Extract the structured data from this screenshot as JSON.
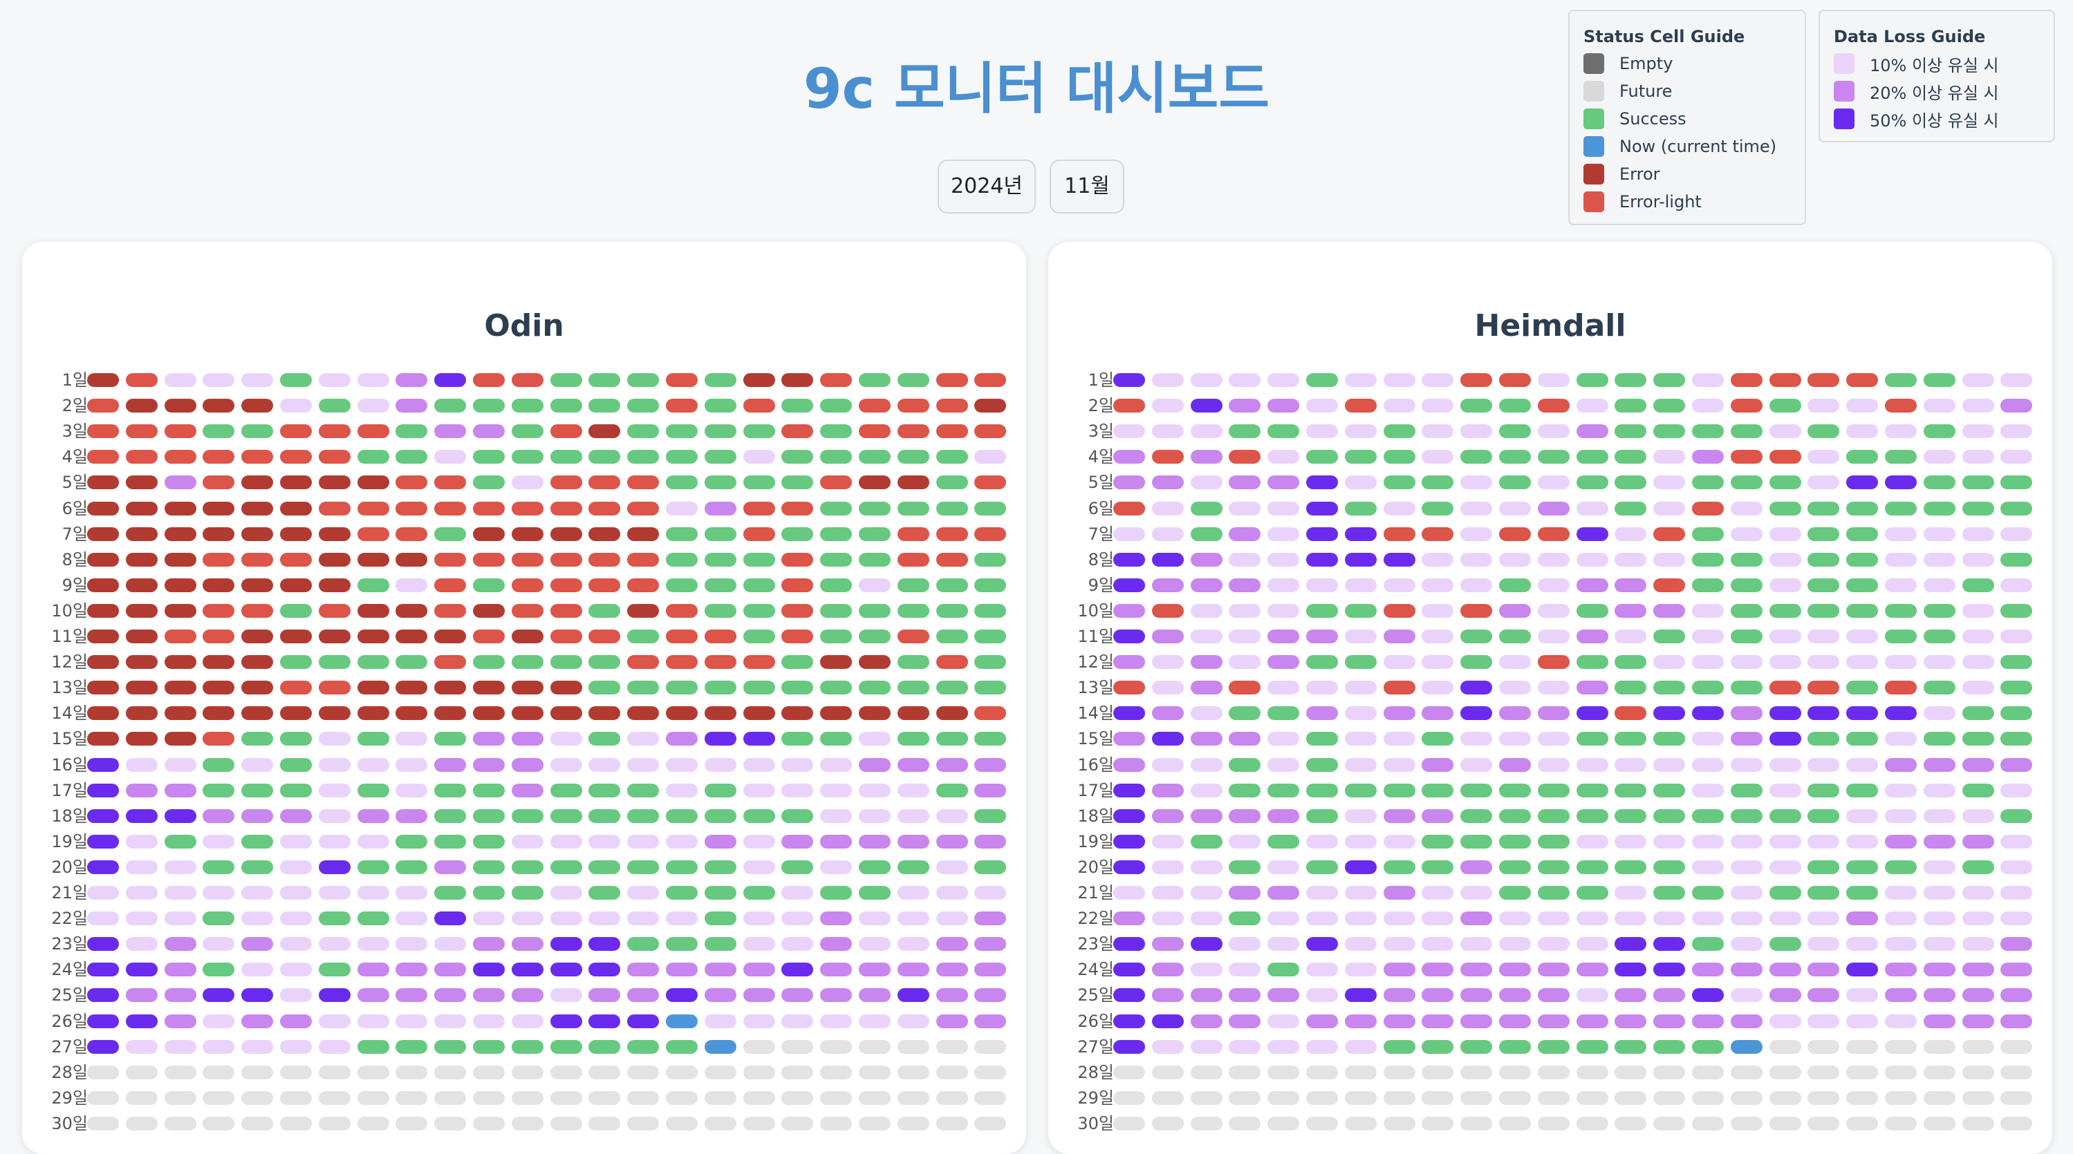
{
  "header": {
    "title": "9c 모니터 대시보드"
  },
  "selectors": {
    "year": "2024년",
    "month": "11월"
  },
  "status_legend": {
    "title": "Status Cell Guide",
    "items": [
      {
        "label": "Empty",
        "color": "#6e6e6e"
      },
      {
        "label": "Future",
        "color": "#d9d9d9"
      },
      {
        "label": "Success",
        "color": "#66c97f"
      },
      {
        "label": "Now (current time)",
        "color": "#4d95d9"
      },
      {
        "label": "Error",
        "color": "#b23b31"
      },
      {
        "label": "Error-light",
        "color": "#dd5448"
      }
    ]
  },
  "loss_legend": {
    "title": "Data Loss Guide",
    "items": [
      {
        "label": "10% 이상 유실 시",
        "color": "#ead3fb"
      },
      {
        "label": "20% 이상 유실 시",
        "color": "#c886ee"
      },
      {
        "label": "50% 이상 유실 시",
        "color": "#6a2bef"
      }
    ]
  },
  "colors": {
    "S": "#66c97f",
    "E": "#b23b31",
    "R": "#dd5448",
    "F": "#e3e3e3",
    "N": "#4d95d9",
    "L": "#ead3fb",
    "M": "#c886ee",
    "D": "#6a2bef"
  },
  "days": [
    "1일",
    "2일",
    "3일",
    "4일",
    "5일",
    "6일",
    "7일",
    "8일",
    "9일",
    "10일",
    "11일",
    "12일",
    "13일",
    "14일",
    "15일",
    "16일",
    "17일",
    "18일",
    "19일",
    "20일",
    "21일",
    "22일",
    "23일",
    "24일",
    "25일",
    "26일",
    "27일",
    "28일",
    "29일",
    "30일"
  ],
  "panels": [
    {
      "name": "Odin",
      "rows": [
        "ERLLLSLLMDRRSSSRSEERSSRR",
        "REEEELSLMSSSSSSRSRSSRRRE",
        "RRRSSRRRSMMSRESSSSRSRRRR",
        "RRRRRRRSSLSSSSSSSLSSSSSL",
        "EEMREEEERRSLRRRSSSSREESR",
        "EEEEEERRRRRRRRRLMRRSSSSS",
        "EEEEEEERRSEEEEESSRSSSRRR",
        "EEERRREEERRRRRRSSSRSSRRS",
        "EEEEEEESLRSRRRRSSSRSLSSS",
        "EEERRSREERERRSERSSRSSSSS",
        "EERREEEEEERERRSRRSRSSRSS",
        "EEEEESSSSRSSSSRRRRSEESRS",
        "EEEEERREEEEEESSSSSSSSSSS",
        "EEEEEEEEEEEEEEEEEEEEEEER",
        "EEERSSLSLSMMLSLMDDSSLSSS",
        "DLLSLSLLLMMMLLLLLLLLMMMM",
        "DMMSSSLSLSSMSSSLSLLLLLSM",
        "DDDMMMLMMSSSSSSSSSSLLLLS",
        "DLSLSLLLSSSLLLLLMLMMMMMM",
        "DLLSSLDSSMSSSSSSSLSLSSLS",
        "LLLLLLLLLSSSLSLSSSLSSLLL",
        "LLLSLLSSLDLLLLLLSLLMLLLM",
        "DLMLMLLLLLMMDDSSSLLMLLMM",
        "DDMSLLSMMMDDDDMMMMDMMMMM",
        "DMMDDLDMMMMMLMMDMMMMMDMM",
        "DDMLMMLLLLLLDDDNLLLLLLMM",
        "DLLLLLLSSSSSSSSSNFFFFFFF",
        "FFFFFFFFFFFFFFFFFFFFFFFF",
        "FFFFFFFFFFFFFFFFFFFFFFFF",
        "FFFFFFFFFFFFFFFFFFFFFFFF"
      ]
    },
    {
      "name": "Heimdall",
      "rows": [
        "DLLLLSLLLRRLSSSLRRRRSSLL",
        "RLDMMLRLLSSRLSSLRSLLRLLM",
        "LLLSSLLSLLSLMSSSSLSLLSLL",
        "MRMRLSSSLSSSSSLMRRLSSLLL",
        "MMLMMDLSSLSLSSLSSSLDDSSS",
        "RLSLLDSLSLLMLSLRLSSSSSSS",
        "LLSMLDDRRLRRDLRSLLSSLLLL",
        "DDMLLDDDLLLLLLLSSLSSLLLS",
        "DMMMLLLLLLSLMMRSSLSSLLSL",
        "MRLLLSSRLRMLSMMLSSSSSSLS",
        "DMLLMMLMLSSLMLSLSLLLSSLL",
        "MLMLMSSLLSLRSSLLLLLLLLLS",
        "RLMRLLLRLDLLMSSSSRRSRSLS",
        "DMLSSMLMMDMMDRDDMDDDDLSS",
        "MDMMLSLLSLLLSSSLMDSSLSSS",
        "MLLSLSLLMLMLLLLLLLLLMMMM",
        "DMLSSSSSSSSSSSSLSLSSLLSL",
        "DMMMMSLMMSSSSSSSSSSLLLLS",
        "DLSLSLLLSSSSLLLLLLLLMMML",
        "DLLSLSDSSMSSSSSLLLSSSLSL",
        "LLLMMLLMLLSSSLSSLSSSLLLL",
        "MLLSLLLLLMLLLLLLLLLMLLLL",
        "DMDLLDLLLLLLLDDSLSLLLLLM",
        "DMLLSLLMMMMMMDDMMMMDMMMM",
        "DMMMMLDMMMMMLMMDLMMLMMMM",
        "DDMMLMMMMMMMMMMMMLLLLMMM",
        "DLLLLLLSSSSSSSSSNFFFFFFF",
        "FFFFFFFFFFFFFFFFFFFFFFFF",
        "FFFFFFFFFFFFFFFFFFFFFFFF",
        "FFFFFFFFFFFFFFFFFFFFFFFF"
      ]
    }
  ]
}
